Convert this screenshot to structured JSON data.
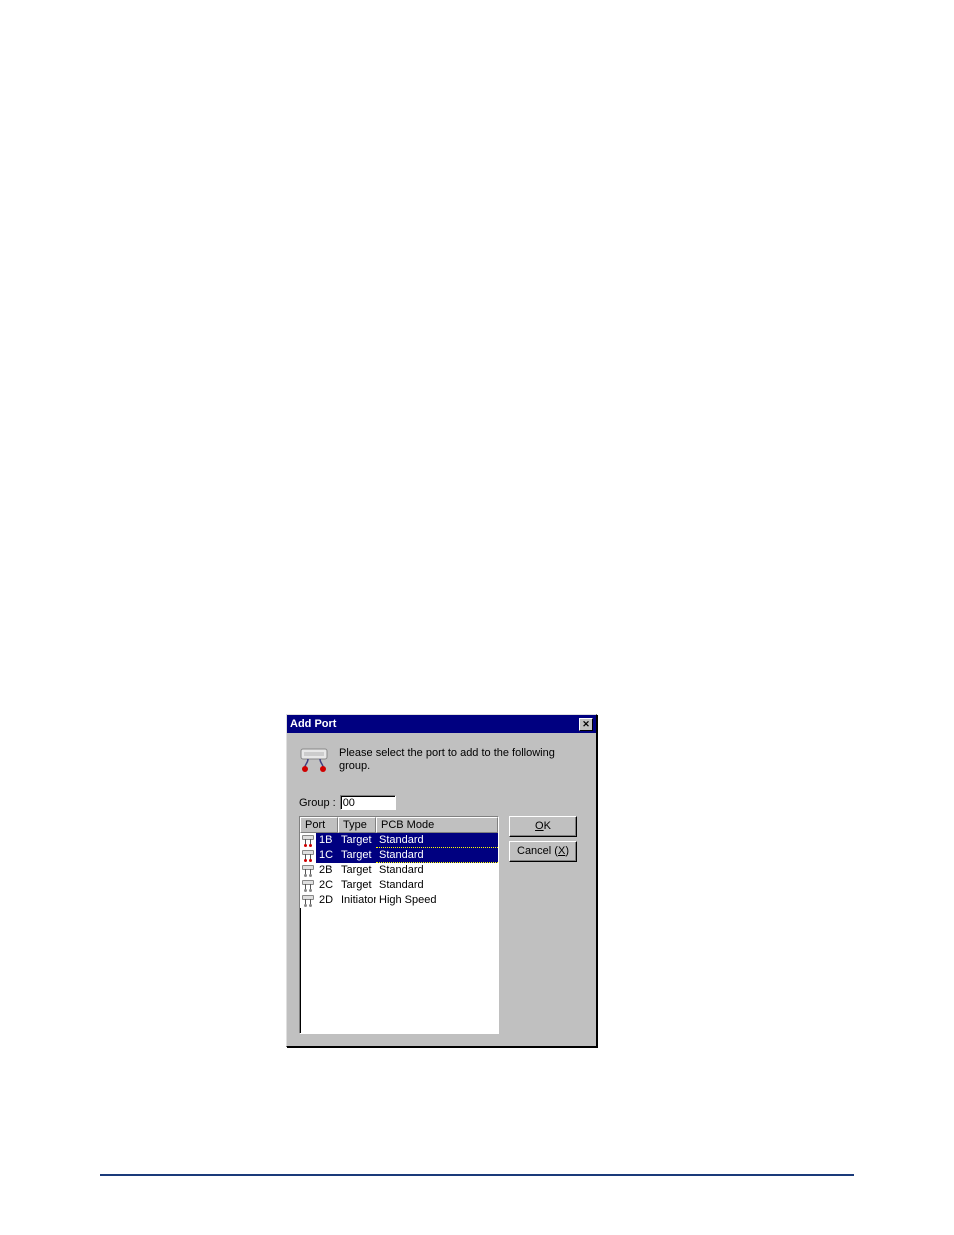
{
  "dialog": {
    "title": "Add Port",
    "instruction": "Please select the port to add to the following group.",
    "group_label": "Group :",
    "group_value": "00",
    "columns": {
      "port": "Port",
      "type": "Type",
      "mode": "PCB Mode"
    },
    "rows": [
      {
        "port": "1B",
        "type": "Target",
        "mode": "Standard",
        "selected": true
      },
      {
        "port": "1C",
        "type": "Target",
        "mode": "Standard",
        "selected": true
      },
      {
        "port": "2B",
        "type": "Target",
        "mode": "Standard",
        "selected": false
      },
      {
        "port": "2C",
        "type": "Target",
        "mode": "Standard",
        "selected": false
      },
      {
        "port": "2D",
        "type": "Initiator",
        "mode": "High Speed",
        "selected": false
      }
    ],
    "buttons": {
      "ok": "OK",
      "ok_hotkey": "O",
      "cancel": "Cancel (X)",
      "cancel_hotkey": "X"
    }
  }
}
